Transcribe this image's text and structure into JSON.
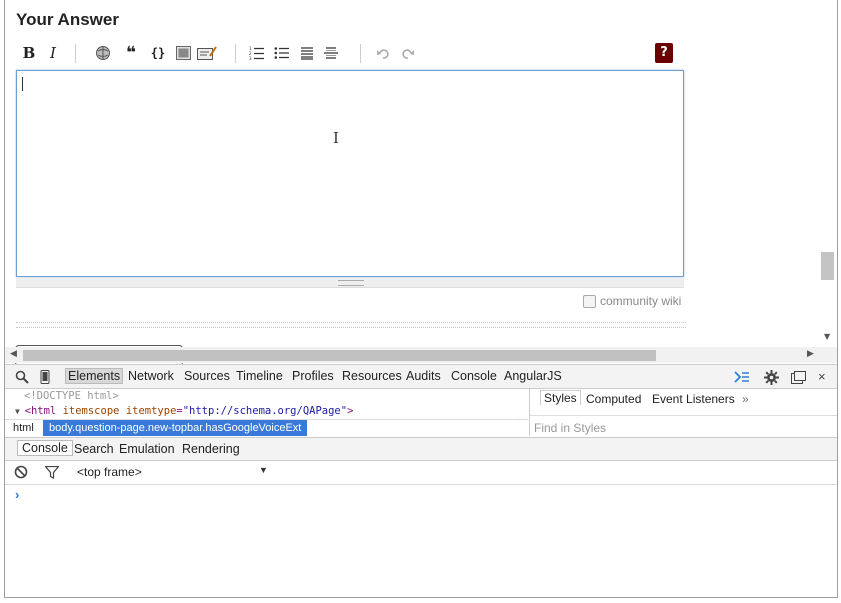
{
  "answer": {
    "title": "Your Answer",
    "help_label": "?",
    "community_wiki_label": "community wiki"
  },
  "toolbar": {
    "bold": "B",
    "italic": "I",
    "quote": "❝",
    "code": "{}"
  },
  "devtools": {
    "tabs": [
      "Elements",
      "Network",
      "Sources",
      "Timeline",
      "Profiles",
      "Resources",
      "Audits",
      "Console",
      "AngularJS"
    ],
    "elements": {
      "doctype": "<!DOCTYPE html>",
      "html_open": "<html",
      "html_attr1": "itemscope",
      "html_attr2": "itemtype",
      "html_attr2_value": "\"http://schema.org/QAPage\"",
      "html_close": ">"
    },
    "breadcrumb": {
      "html": "html",
      "body": "body.question-page.new-topbar.hasGoogleVoiceExt"
    },
    "styles_tabs": [
      "Styles",
      "Computed",
      "Event Listeners",
      "»"
    ],
    "find_placeholder": "Find in Styles",
    "drawer_tabs": [
      "Console",
      "Search",
      "Emulation",
      "Rendering"
    ],
    "frame_select": "<top frame>",
    "prompt": "›"
  },
  "colors": {
    "accent": "#3879d9",
    "help_bg": "#6a0000",
    "editor_border": "#6e9fd0"
  }
}
